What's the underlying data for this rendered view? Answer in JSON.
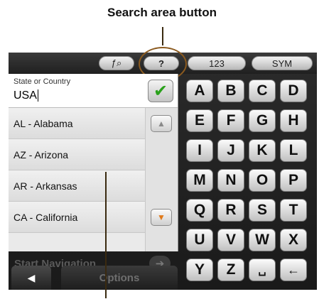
{
  "annotations": {
    "top_label": "Search area button"
  },
  "topbar": {
    "search_icon_label": "ƒ⌕",
    "help_label": "?",
    "numbers_label": "123",
    "symbols_label": "SYM"
  },
  "field": {
    "label": "State or Country",
    "value": "USA"
  },
  "list": {
    "items": [
      "AL - Alabama",
      "AZ - Arizona",
      "AR - Arkansas",
      "CA - California"
    ]
  },
  "bottom": {
    "start_navigation": "Start Navigation",
    "options": "Options"
  },
  "keyboard": {
    "rows": [
      [
        "A",
        "B",
        "C",
        "D"
      ],
      [
        "E",
        "F",
        "G",
        "H"
      ],
      [
        "I",
        "J",
        "K",
        "L"
      ],
      [
        "M",
        "N",
        "O",
        "P"
      ],
      [
        "Q",
        "R",
        "S",
        "T"
      ],
      [
        "U",
        "V",
        "W",
        "X"
      ],
      [
        "Y",
        "Z",
        "␣",
        "←"
      ]
    ]
  },
  "colors": {
    "checkmark": "#2aa11b",
    "scroll_down_accent": "#e07a1a",
    "callout": "#8b5a1f"
  }
}
